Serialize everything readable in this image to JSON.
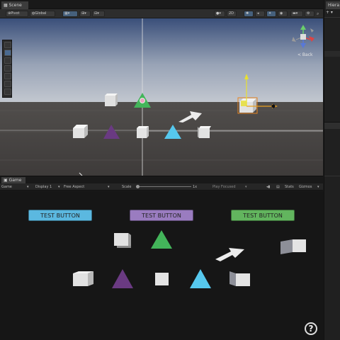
{
  "scene": {
    "tab_label": "Scene",
    "toolbar": {
      "pivot_label": "Pivot",
      "global_label": "Global",
      "twod_label": "2D",
      "back_label": "< Back"
    }
  },
  "game": {
    "tab_label": "Game",
    "toolbar": {
      "mode_select": "Game",
      "display_select": "Display 1",
      "aspect_select": "Free Aspect",
      "scale_label": "Scale",
      "scale_value": "1x",
      "play_focus_label": "Play Focused",
      "stats_label": "Stats",
      "gizmos_label": "Gizmos"
    },
    "buttons": [
      {
        "label": "TEST BUTTON",
        "color": "#5bb8e0"
      },
      {
        "label": "TEST BUTTON",
        "color": "#9a7cc0"
      },
      {
        "label": "TEST BUTTON",
        "color": "#62b55e"
      }
    ],
    "help_label": "?"
  },
  "right_panel": {
    "tab_label": "Hiera"
  },
  "colors": {
    "triangle_green": "#43b55a",
    "triangle_purple": "#6a3a82",
    "triangle_cyan": "#56c8ee",
    "cube": "#e2e2e2",
    "axis_y": "#e8e030",
    "axis_x": "#e8a020"
  }
}
